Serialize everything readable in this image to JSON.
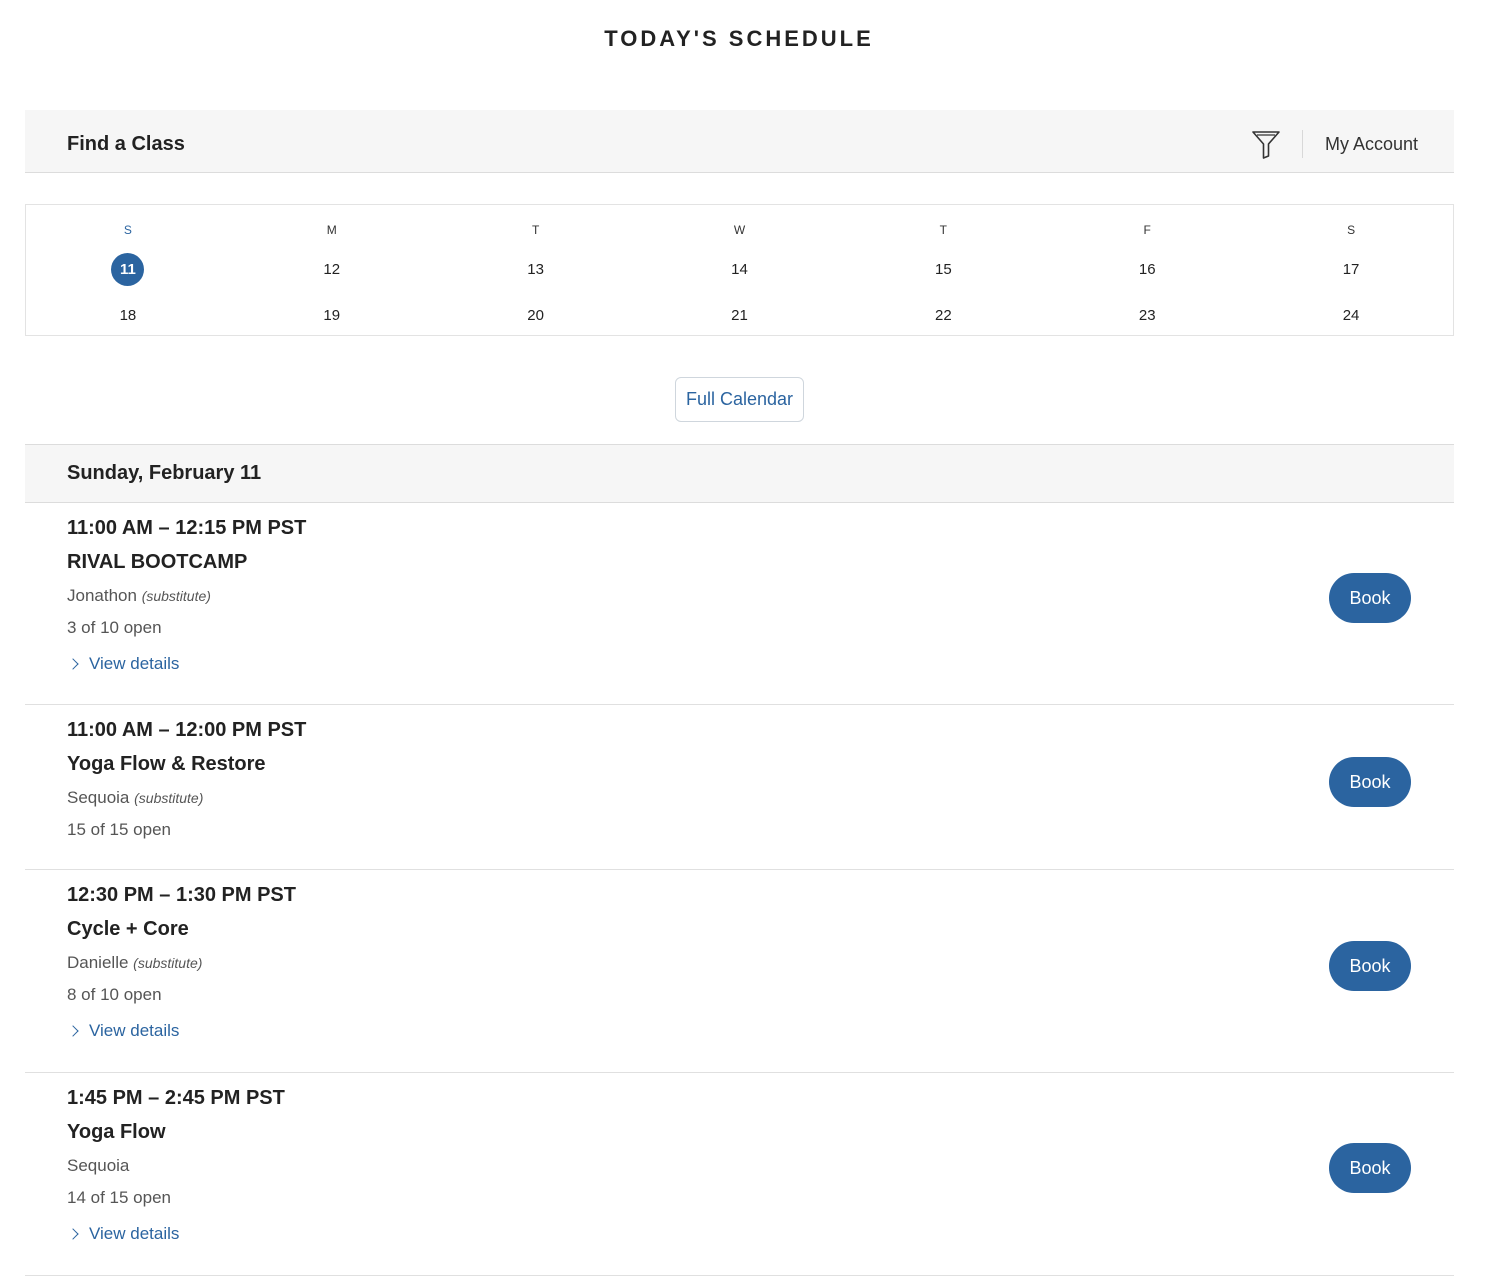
{
  "page_title": "TODAY'S SCHEDULE",
  "header": {
    "title": "Find a Class",
    "filter_icon": "funnel-filter-icon",
    "account_label": "My Account"
  },
  "calendar": {
    "weekdays": [
      "S",
      "M",
      "T",
      "W",
      "T",
      "F",
      "S"
    ],
    "active_weekday": "S",
    "weeks": [
      [
        "11",
        "12",
        "13",
        "14",
        "15",
        "16",
        "17"
      ],
      [
        "18",
        "19",
        "20",
        "21",
        "22",
        "23",
        "24"
      ]
    ],
    "selected_day": "11",
    "full_calendar_label": "Full Calendar"
  },
  "date_heading": "Sunday, February 11",
  "classes": [
    {
      "time": "11:00 AM – 12:15 PM PST",
      "name": "RIVAL BOOTCAMP",
      "instructor": "Jonathon",
      "instructor_note": "(substitute)",
      "availability": "3 of 10 open",
      "details_label": "View details",
      "book_label": "Book"
    },
    {
      "time": "11:00 AM – 12:00 PM PST",
      "name": "Yoga Flow & Restore",
      "instructor": "Sequoia",
      "instructor_note": "(substitute)",
      "availability": "15 of 15 open",
      "details_label": "",
      "book_label": "Book"
    },
    {
      "time": "12:30 PM – 1:30 PM PST",
      "name": "Cycle + Core",
      "instructor": "Danielle",
      "instructor_note": "(substitute)",
      "availability": "8 of 10 open",
      "details_label": "View details",
      "book_label": "Book"
    },
    {
      "time": "1:45 PM – 2:45 PM PST",
      "name": "Yoga Flow",
      "instructor": "Sequoia",
      "instructor_note": "",
      "availability": "14 of 15 open",
      "details_label": "View details",
      "book_label": "Book"
    }
  ],
  "colors": {
    "accent": "#2b64a0",
    "bar_background": "#f6f6f6",
    "text": "#222222",
    "muted_text": "#555555"
  }
}
